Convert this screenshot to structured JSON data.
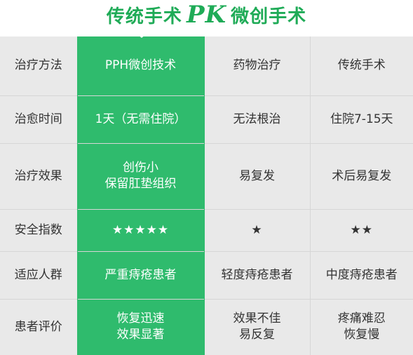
{
  "header": {
    "title_left": "传统手术",
    "title_pk": "PK",
    "title_right": "微创手术"
  },
  "colors": {
    "accent": "#2fbb6d",
    "title": "#1fab57",
    "cell_bg": "#e9e9e9",
    "grid": "#d6d6d6"
  },
  "rows": [
    {
      "label": "治疗方法",
      "pph": [
        "PPH微创技术"
      ],
      "drug": [
        "药物治疗"
      ],
      "traditional": [
        "传统手术"
      ]
    },
    {
      "label": "治愈时间",
      "pph": [
        "1天（无需住院）"
      ],
      "drug": [
        "无法根治"
      ],
      "traditional": [
        "住院7-15天"
      ]
    },
    {
      "label": "治疗效果",
      "pph": [
        "创伤小",
        "保留肛垫组织"
      ],
      "drug": [
        "易复发"
      ],
      "traditional": [
        "术后易复发"
      ]
    },
    {
      "label": "安全指数",
      "pph": [
        "★★★★★"
      ],
      "drug": [
        "★"
      ],
      "traditional": [
        "★★"
      ]
    },
    {
      "label": "适应人群",
      "pph": [
        "严重痔疮患者"
      ],
      "drug": [
        "轻度痔疮患者"
      ],
      "traditional": [
        "中度痔疮患者"
      ]
    },
    {
      "label": "患者评价",
      "pph": [
        "恢复迅速",
        "效果显著"
      ],
      "drug": [
        "效果不佳",
        "易反复"
      ],
      "traditional": [
        "疼痛难忍",
        "恢复慢"
      ]
    }
  ]
}
